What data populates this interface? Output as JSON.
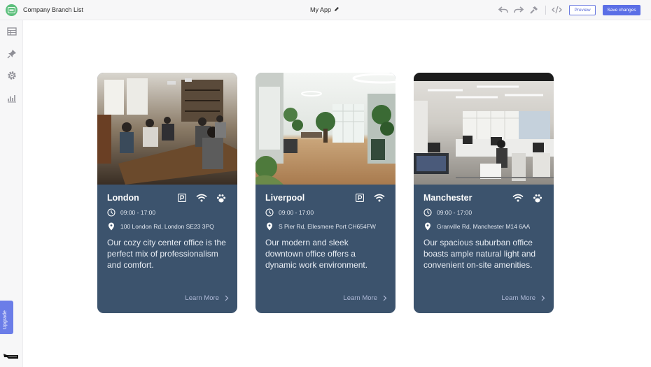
{
  "header": {
    "page_title": "Company Branch List",
    "app_name": "My App",
    "preview_label": "Preview",
    "save_label": "Save changes"
  },
  "sidebar": {
    "items": [
      "table-icon",
      "pin-icon",
      "gear-icon",
      "chart-icon"
    ],
    "upgrade_label": "Upgrade"
  },
  "colors": {
    "card_bg": "#3c536d",
    "accent": "#5b6fe6",
    "logo": "#5cbf7c"
  },
  "branches": [
    {
      "name": "London",
      "hours": "09:00 - 17:00",
      "address": "100 London Rd, London SE23 3PQ",
      "description": "Our cozy city center office is the perfect mix of professionalism and comfort.",
      "amenities": [
        "parking-icon",
        "wifi-icon",
        "paw-icon"
      ],
      "cta": "Learn More"
    },
    {
      "name": "Liverpool",
      "hours": "09:00 - 17:00",
      "address": "S Pier Rd, Ellesmere Port CH654FW",
      "description": "Our modern and sleek downtown office offers a dynamic work environment.",
      "amenities": [
        "parking-icon",
        "wifi-icon"
      ],
      "cta": "Learn More"
    },
    {
      "name": "Manchester",
      "hours": "09:00 - 17:00",
      "address": "Granville Rd, Manchester M14 6AA",
      "description": "Our spacious suburban office boasts ample natural light and convenient on-site amenities.",
      "amenities": [
        "wifi-icon",
        "paw-icon"
      ],
      "cta": "Learn More"
    }
  ]
}
